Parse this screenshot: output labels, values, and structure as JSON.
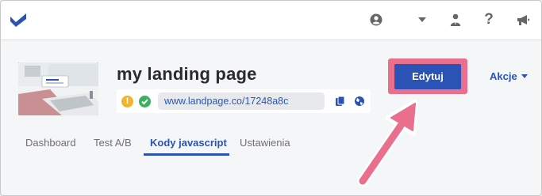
{
  "topbar": {
    "icons": [
      "logo-icon",
      "user-circle-icon",
      "caret-down-icon",
      "account-icon",
      "help-icon",
      "megaphone-icon"
    ],
    "help_label": "?"
  },
  "page": {
    "title": "my landing page",
    "url": "www.landpage.co/17248a8c",
    "status_warning": "!",
    "status_ok_icon": "check-icon"
  },
  "actions": {
    "edit_label": "Edytuj",
    "actions_label": "Akcje"
  },
  "tabs": [
    {
      "label": "Dashboard",
      "active": false
    },
    {
      "label": "Test A/B",
      "active": false
    },
    {
      "label": "Kody javascript",
      "active": true
    },
    {
      "label": "Ustawienia",
      "active": false
    }
  ],
  "colors": {
    "accent": "#2a53b5",
    "highlight": "#ea6f8e",
    "warning": "#f0b52a",
    "success": "#3cb060"
  }
}
